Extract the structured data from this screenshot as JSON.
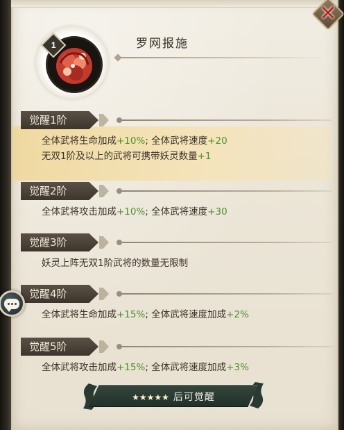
{
  "hero": {
    "rank": "1",
    "name": "罗网报施"
  },
  "awakenings": [
    {
      "tag": "觉醒1阶",
      "active": true,
      "lines": [
        {
          "parts": [
            "全体武将生命加成",
            "+10%",
            "; 全体武将速度",
            "+20"
          ]
        },
        {
          "parts": [
            "无双1阶及以上的武将可携带妖灵数量",
            "+1"
          ]
        }
      ]
    },
    {
      "tag": "觉醒2阶",
      "active": false,
      "lines": [
        {
          "parts": [
            "全体武将攻击加成",
            "+10%",
            "; 全体武将速度",
            "+30"
          ]
        }
      ]
    },
    {
      "tag": "觉醒3阶",
      "active": false,
      "lines": [
        {
          "parts": [
            "妖灵上阵无双1阶武将的数量无限制"
          ]
        }
      ]
    },
    {
      "tag": "觉醒4阶",
      "active": false,
      "lines": [
        {
          "parts": [
            "全体武将生命加成",
            "+15%",
            "; 全体武将速度加成",
            "+2%"
          ]
        }
      ]
    },
    {
      "tag": "觉醒5阶",
      "active": false,
      "lines": [
        {
          "parts": [
            "全体武将攻击加成",
            "+15%",
            "; 全体武将速度加成",
            "+3%"
          ]
        }
      ]
    }
  ],
  "footer": {
    "stars": "★★★★★",
    "label": "后可觉醒"
  },
  "icons": {
    "close": "close-icon",
    "chat": "chat-bubble-icon"
  },
  "colors": {
    "highlight_value": "#4f8f2c",
    "active_row_bg": "#f2d99a",
    "tag_bg": "#4b4238"
  }
}
